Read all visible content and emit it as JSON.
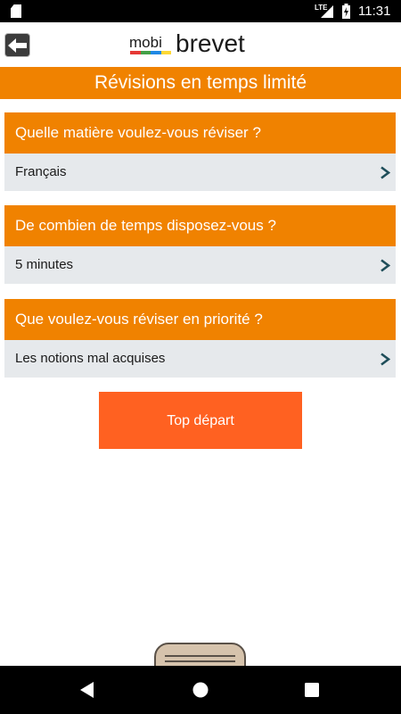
{
  "status": {
    "network": "LTE",
    "time": "11:31"
  },
  "header": {
    "logo_small": "mobi",
    "logo_large": "brevet",
    "logo_bar_colors": [
      "#e53935",
      "#43a047",
      "#1e88e5",
      "#fdd835"
    ]
  },
  "title": "Révisions en temps limité",
  "questions": [
    {
      "label": "Quelle matière voulez-vous réviser ?",
      "value": "Français"
    },
    {
      "label": "De combien de temps disposez-vous ?",
      "value": "5 minutes"
    },
    {
      "label": "Que voulez-vous réviser en priorité ?",
      "value": "Les notions mal acquises"
    }
  ],
  "start_button": "Top départ",
  "colors": {
    "accent": "#f08200",
    "start_button": "#ff6121",
    "row_background": "#e6e9ec",
    "chevron": "#1f4e5a"
  }
}
